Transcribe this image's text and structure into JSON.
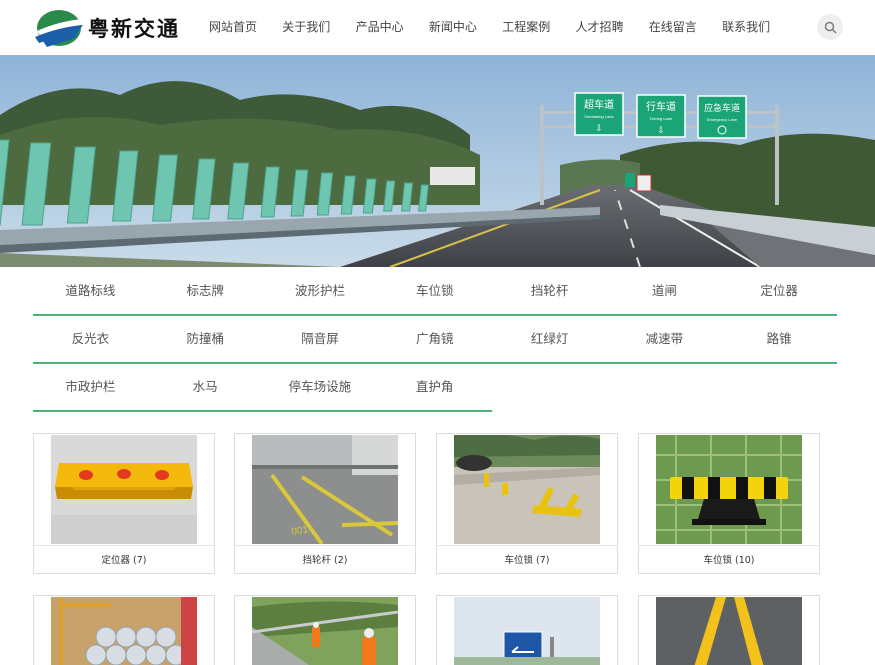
{
  "brand": {
    "name": "粤新交通"
  },
  "nav": {
    "items": [
      "网站首页",
      "关于我们",
      "产品中心",
      "新闻中心",
      "工程案例",
      "人才招聘",
      "在线留言",
      "联系我们"
    ]
  },
  "banner": {
    "signs": [
      {
        "title": "超车道",
        "sub": "Overtaking Lane"
      },
      {
        "title": "行车道",
        "sub": "Driving Lane"
      },
      {
        "title": "应急车道",
        "sub": "Emergency Lane"
      }
    ]
  },
  "categories": {
    "row1": [
      "道路标线",
      "标志牌",
      "波形护栏",
      "车位锁",
      "挡轮杆",
      "道闸",
      "定位器"
    ],
    "row2": [
      "反光衣",
      "防撞桶",
      "隔音屏",
      "广角镜",
      "红绿灯",
      "减速带",
      "路锥"
    ],
    "row3": [
      "市政护栏",
      "水马",
      "停车场设施",
      "直护角"
    ]
  },
  "products": [
    {
      "caption": "定位器 (7)"
    },
    {
      "caption": "挡轮杆 (2)"
    },
    {
      "caption": "车位锁 (7)"
    },
    {
      "caption": "车位锁 (10)"
    }
  ],
  "colors": {
    "accent": "#4fb07a",
    "sign_green": "#1aa478"
  }
}
